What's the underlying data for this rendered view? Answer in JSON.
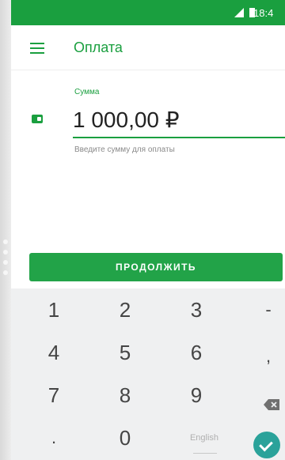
{
  "status_bar": {
    "time": "18:4"
  },
  "app_bar": {
    "title": "Оплата"
  },
  "amount_field": {
    "label": "Сумма",
    "value": "1 000,00 ₽",
    "hint": "Введите сумму для оплаты"
  },
  "continue_button": {
    "label": "ПРОДОЛЖИТЬ"
  },
  "keyboard": {
    "rows": [
      [
        "1",
        "2",
        "3",
        "-"
      ],
      [
        "4",
        "5",
        "6",
        ","
      ],
      [
        "7",
        "8",
        "9",
        ""
      ],
      [
        ".",
        "0",
        "English",
        ""
      ]
    ],
    "language": "English"
  },
  "colors": {
    "brand": "#1a9f3f",
    "button": "#22a348",
    "enter": "#2aa29a"
  }
}
